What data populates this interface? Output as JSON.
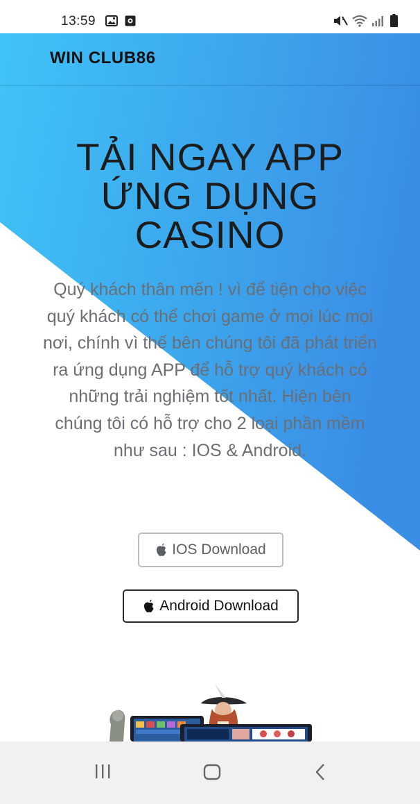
{
  "status_bar": {
    "time": "13:59",
    "icons": [
      "gallery-icon",
      "record-icon",
      "mute-icon",
      "wifi-icon",
      "signal-icon",
      "battery-icon"
    ]
  },
  "header": {
    "brand": "WIN CLUB86"
  },
  "hero": {
    "title_lines": [
      "TẢI NGAY APP",
      "ỨNG DỤNG",
      "CASINO"
    ],
    "description": "Quý khách thân mến ! vì để tiện cho việc quý khách có thể chơi game ở mọi lúc mọi nơi, chính vì thế bên chúng tôi đã phát triển ra ứng dụng APP để hỗ trợ quý khách có những trải nghiệm tốt nhất. Hiện bên chúng tôi có hỗ trợ cho 2 loại phần mềm như sau : IOS & Android.",
    "ios_button": "IOS Download",
    "android_button": "Android Download",
    "button_icon": "apple-icon"
  },
  "colors": {
    "gradient_start": "#3fbff5",
    "gradient_end": "#3a8fe6",
    "ios_border": "#b9bcc1",
    "android_border": "#2a2a2a",
    "nav_bar_bg": "#f1f1f3"
  },
  "nav_bar": {
    "icons": [
      "recents-icon",
      "home-icon",
      "back-icon"
    ]
  }
}
